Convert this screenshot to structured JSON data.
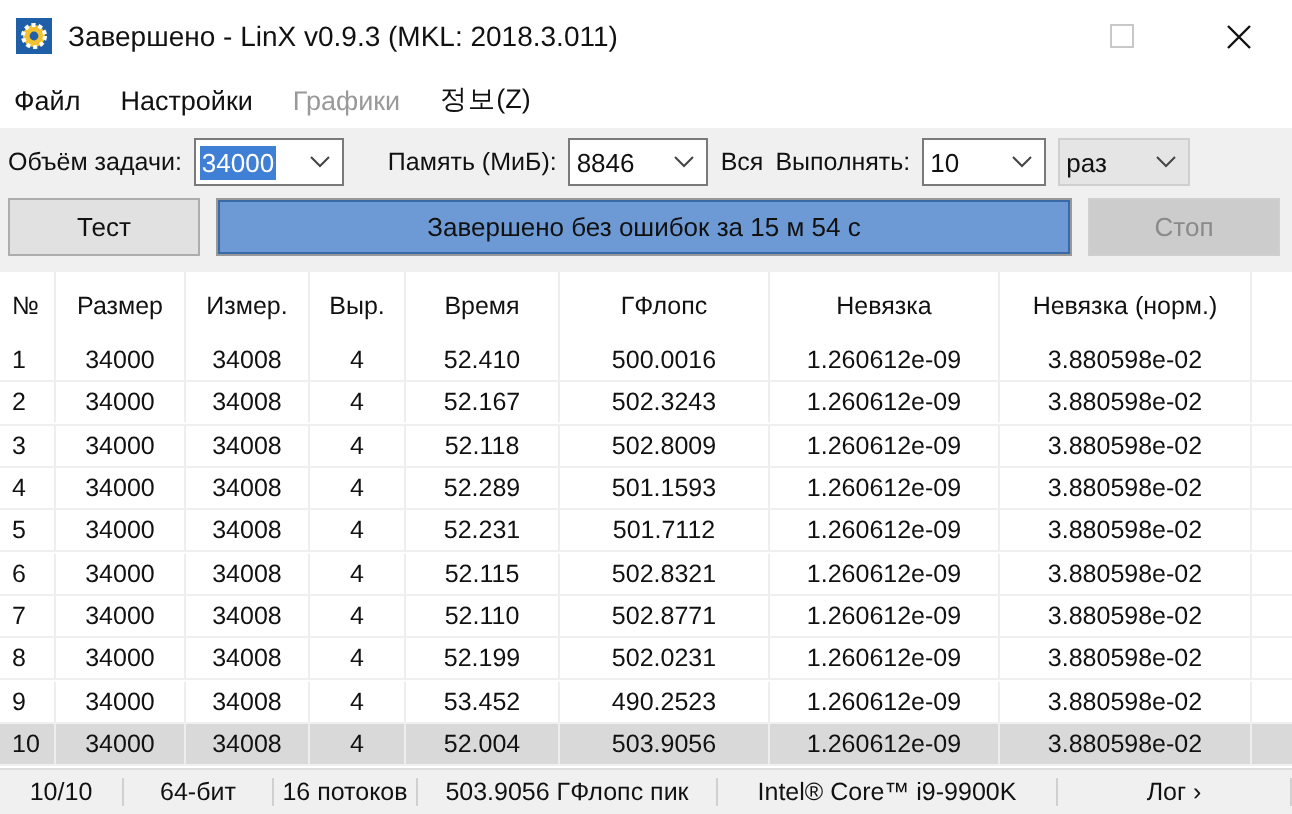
{
  "window": {
    "title": "Завершено - LinX v0.9.3 (MKL: 2018.3.011)"
  },
  "menu": [
    {
      "label": "Файл",
      "disabled": false
    },
    {
      "label": "Настройки",
      "disabled": false
    },
    {
      "label": "Графики",
      "disabled": true
    },
    {
      "label": "정보(Z)",
      "disabled": false
    }
  ],
  "settings": {
    "size_label": "Объём задачи:",
    "size_value": "34000",
    "size_text_selected": true,
    "memory_label": "Память (МиБ):",
    "memory_value": "8846",
    "all_label": "Вся",
    "runs_label": "Выполнять:",
    "runs_value": "10",
    "runs_unit": "раз"
  },
  "controls": {
    "test_button": {
      "label": "Тест",
      "disabled": false
    },
    "progress": {
      "label": "Завершено без ошибок за 15 м 54 с",
      "level": 1
    },
    "stop_button": {
      "label": "Стоп",
      "disabled": true
    }
  },
  "table": {
    "columns": [
      "№",
      "Размер",
      "Измер.",
      "Выр.",
      "Время",
      "ГФлопс",
      "Невязка",
      "Невязка (норм.)"
    ],
    "rows": [
      {
        "cells": [
          "1",
          "34000",
          "34008",
          "4",
          "52.410",
          "500.0016",
          "1.260612e-09",
          "3.880598e-02"
        ],
        "selected": false
      },
      {
        "cells": [
          "2",
          "34000",
          "34008",
          "4",
          "52.167",
          "502.3243",
          "1.260612e-09",
          "3.880598e-02"
        ],
        "selected": false
      },
      {
        "cells": [
          "3",
          "34000",
          "34008",
          "4",
          "52.118",
          "502.8009",
          "1.260612e-09",
          "3.880598e-02"
        ],
        "selected": false
      },
      {
        "cells": [
          "4",
          "34000",
          "34008",
          "4",
          "52.289",
          "501.1593",
          "1.260612e-09",
          "3.880598e-02"
        ],
        "selected": false
      },
      {
        "cells": [
          "5",
          "34000",
          "34008",
          "4",
          "52.231",
          "501.7112",
          "1.260612e-09",
          "3.880598e-02"
        ],
        "selected": false
      },
      {
        "cells": [
          "6",
          "34000",
          "34008",
          "4",
          "52.115",
          "502.8321",
          "1.260612e-09",
          "3.880598e-02"
        ],
        "selected": false
      },
      {
        "cells": [
          "7",
          "34000",
          "34008",
          "4",
          "52.110",
          "502.8771",
          "1.260612e-09",
          "3.880598e-02"
        ],
        "selected": false
      },
      {
        "cells": [
          "8",
          "34000",
          "34008",
          "4",
          "52.199",
          "502.0231",
          "1.260612e-09",
          "3.880598e-02"
        ],
        "selected": false
      },
      {
        "cells": [
          "9",
          "34000",
          "34008",
          "4",
          "53.452",
          "490.2523",
          "1.260612e-09",
          "3.880598e-02"
        ],
        "selected": false
      },
      {
        "cells": [
          "10",
          "34000",
          "34008",
          "4",
          "52.004",
          "503.9056",
          "1.260612e-09",
          "3.880598e-02"
        ],
        "selected": true
      }
    ]
  },
  "status_bar": [
    "10/10",
    "64-бит",
    "16 потоков",
    "503.9056 ГФлопс пик",
    "Intel® Core™ i9-9900K",
    "Лог ›"
  ]
}
